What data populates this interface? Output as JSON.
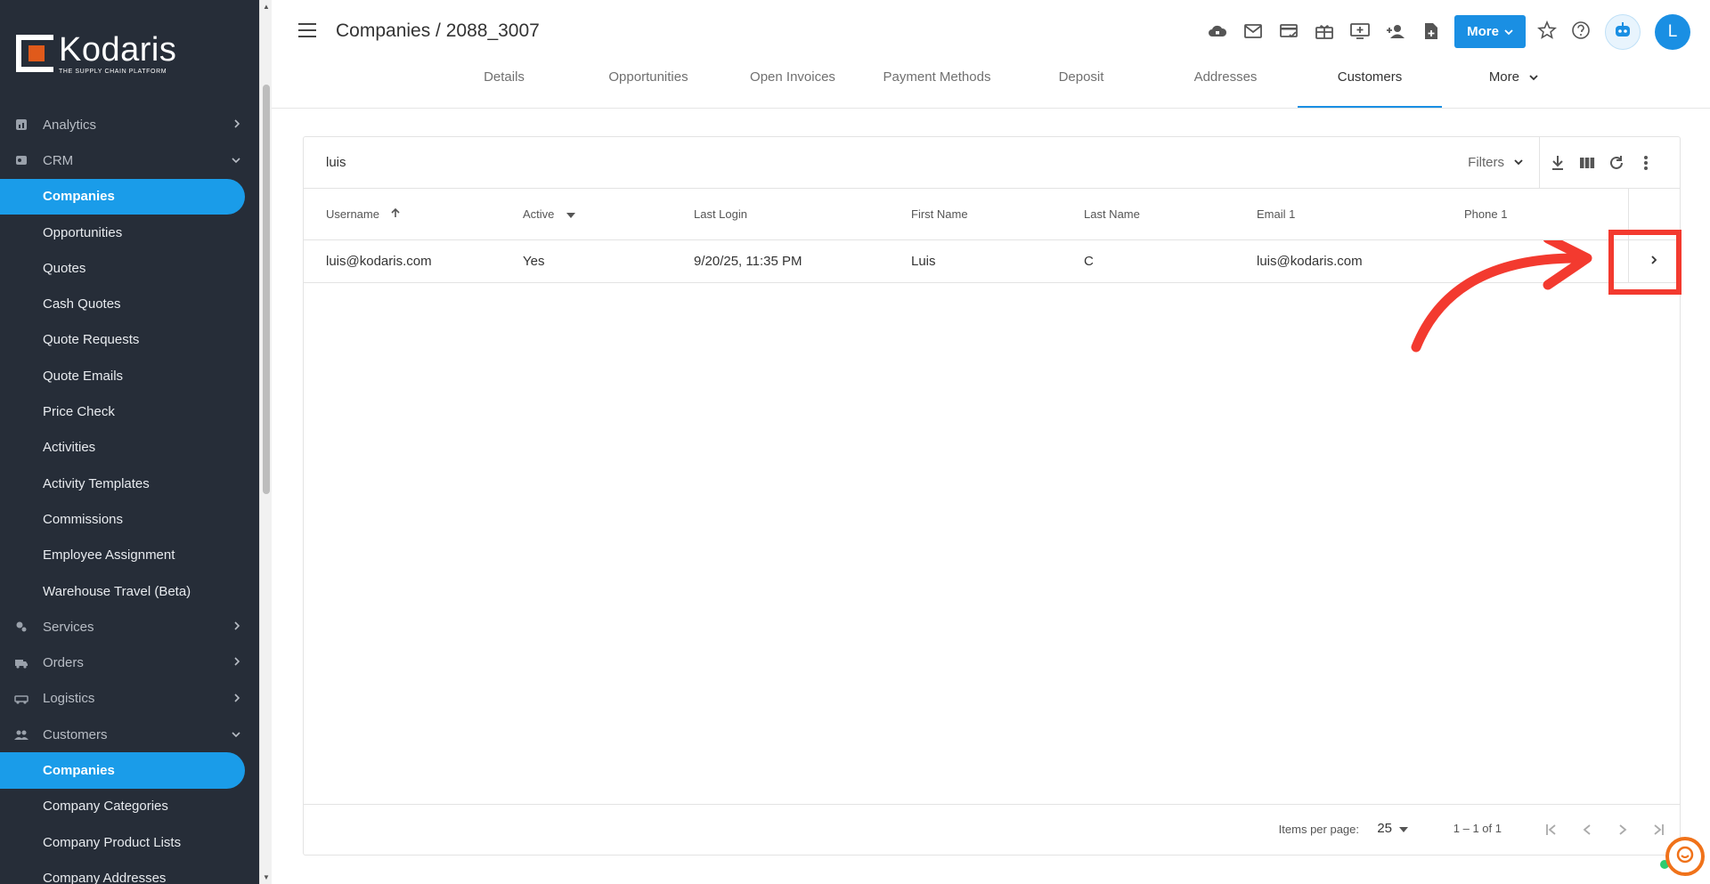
{
  "brand": {
    "name": "Kodaris",
    "tagline": "THE SUPPLY CHAIN PLATFORM"
  },
  "sidebar": {
    "items": [
      {
        "label": "Analytics",
        "type": "group",
        "icon": "analytics-icon",
        "expanded": false
      },
      {
        "label": "CRM",
        "type": "group",
        "icon": "crm-icon",
        "expanded": true
      },
      {
        "label": "Companies",
        "type": "sub",
        "active": true
      },
      {
        "label": "Opportunities",
        "type": "sub"
      },
      {
        "label": "Quotes",
        "type": "sub"
      },
      {
        "label": "Cash Quotes",
        "type": "sub"
      },
      {
        "label": "Quote Requests",
        "type": "sub"
      },
      {
        "label": "Quote Emails",
        "type": "sub"
      },
      {
        "label": "Price Check",
        "type": "sub"
      },
      {
        "label": "Activities",
        "type": "sub"
      },
      {
        "label": "Activity Templates",
        "type": "sub"
      },
      {
        "label": "Commissions",
        "type": "sub"
      },
      {
        "label": "Employee Assignment",
        "type": "sub"
      },
      {
        "label": "Warehouse Travel (Beta)",
        "type": "sub"
      },
      {
        "label": "Services",
        "type": "group",
        "icon": "services-icon",
        "expanded": false
      },
      {
        "label": "Orders",
        "type": "group",
        "icon": "orders-icon",
        "expanded": false
      },
      {
        "label": "Logistics",
        "type": "group",
        "icon": "logistics-icon",
        "expanded": false
      },
      {
        "label": "Customers",
        "type": "group",
        "icon": "customers-icon",
        "expanded": true
      },
      {
        "label": "Companies",
        "type": "sub",
        "active": true
      },
      {
        "label": "Company Categories",
        "type": "sub"
      },
      {
        "label": "Company Product Lists",
        "type": "sub"
      },
      {
        "label": "Company Addresses",
        "type": "sub"
      }
    ]
  },
  "header": {
    "title": "Companies / 2088_3007",
    "more_label": "More",
    "avatar_initial": "L",
    "icons": [
      "cloud-lock-icon",
      "mail-icon",
      "card-check-icon",
      "gift-card-icon",
      "add-screen-icon",
      "add-person-icon",
      "add-document-icon",
      "attach-icon"
    ]
  },
  "tabs": [
    "Details",
    "Opportunities",
    "Open Invoices",
    "Payment Methods",
    "Deposit",
    "Addresses",
    "Customers",
    "More"
  ],
  "active_tab": "Customers",
  "search": {
    "value": "luis",
    "filters_label": "Filters"
  },
  "table": {
    "columns": [
      "Username",
      "Active",
      "Last Login",
      "First Name",
      "Last Name",
      "Email 1",
      "Phone 1"
    ],
    "rows": [
      [
        "luis@kodaris.com",
        "Yes",
        "9/20/25, 11:35 PM",
        "Luis",
        "C",
        "luis@kodaris.com",
        ""
      ]
    ]
  },
  "footer": {
    "items_per_page_label": "Items per page:",
    "items_per_page": "25",
    "range": "1 – 1 of 1"
  },
  "colors": {
    "accent": "#1a8fe3",
    "sidebar": "#262d38",
    "annotation": "#f33a2f",
    "chat": "#f0721a"
  }
}
